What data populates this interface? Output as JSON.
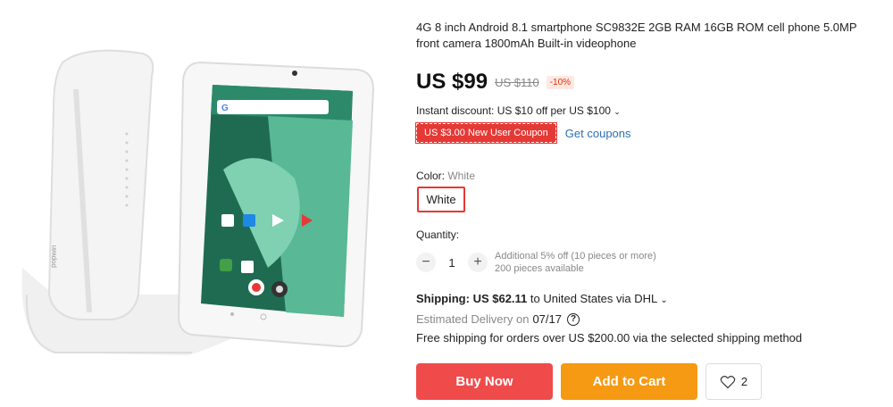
{
  "product": {
    "title": "4G 8 inch Android 8.1 smartphone SC9832E 2GB RAM 16GB ROM cell phone 5.0MP front camera 1800mAh Built-in videophone",
    "price": "US $99",
    "old_price": "US $110",
    "discount": "-10%",
    "instant_discount": "Instant discount: US $10 off per US $100",
    "coupon": "US $3.00 New User Coupon",
    "get_coupons": "Get coupons",
    "color_label": "Color:",
    "color_value": "White",
    "color_option": "White",
    "quantity_label": "Quantity:",
    "quantity": "1",
    "qty_note_1": "Additional 5% off (10 pieces or more)",
    "qty_note_2": "200 pieces available",
    "shipping_label": "Shipping:",
    "shipping_price": "US $62.11",
    "shipping_dest": "to United States via DHL",
    "est_label": "Estimated Delivery on",
    "est_date": "07/17",
    "free_ship": "Free shipping for orders over US $200.00 via the selected shipping method",
    "buy_now": "Buy Now",
    "add_to_cart": "Add to Cart",
    "wish_count": "2",
    "brand_on_device": "popwin"
  },
  "colors": {
    "accent": "#e53935",
    "buy": "#f04b4b",
    "cart": "#f59a12",
    "link": "#2e6fb7"
  }
}
